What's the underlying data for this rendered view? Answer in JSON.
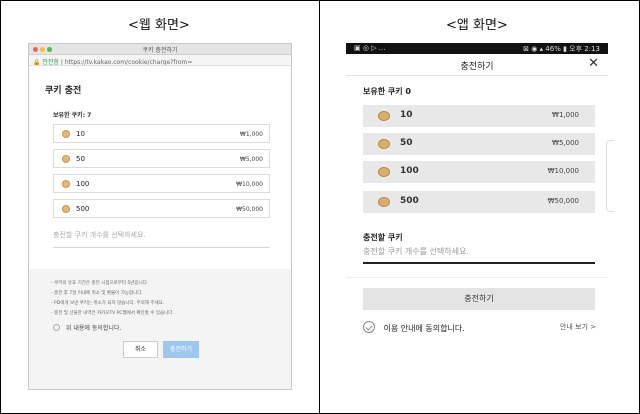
{
  "captions": {
    "web": "<웹 화면>",
    "app": "<앱 화면>"
  },
  "web": {
    "window_title": "쿠키 충전하기",
    "url_secure": "안전함",
    "url": "https://tv.kakao.com/cookie/charge?from=",
    "page_title": "쿠키 충전",
    "owned": "보유한 쿠키: 7",
    "options": [
      {
        "amount": "10",
        "price": "₩1,000"
      },
      {
        "amount": "50",
        "price": "₩5,000"
      },
      {
        "amount": "100",
        "price": "₩10,000"
      },
      {
        "amount": "500",
        "price": "₩50,000"
      }
    ],
    "input_placeholder": "충전할 쿠키 개수를 선택하세요.",
    "notices": [
      "- 쿠키의 유효 기간은 충전 시점으로부터 5년입니다.",
      "- 충전 후 7일 이내에 취소 및 환불이 가능합니다.",
      "- PD에게 보낸 쿠키는 취소가 되지 않습니다. 주의해 주세요.",
      "- 충전 및 선물한 내역은 카카오TV PC웹에서 확인할 수 있습니다."
    ],
    "agree": "위 내용에 동의합니다.",
    "cancel": "취소",
    "charge": "충전하기"
  },
  "app": {
    "status_left": "▣ ◎ ▷ ...",
    "status_right": "⊠ ◉ ▴ 46% ▮ 오후 2:13",
    "title": "충전하기",
    "close": "✕",
    "owned": "보유한 쿠키 0",
    "options": [
      {
        "amount": "10",
        "price": "₩1,000"
      },
      {
        "amount": "50",
        "price": "₩5,000"
      },
      {
        "amount": "100",
        "price": "₩10,000"
      },
      {
        "amount": "500",
        "price": "₩50,000"
      }
    ],
    "input_label": "충전할 쿠키",
    "input_placeholder": "충전할 쿠키 개수를 선택하세요.",
    "charge": "충전하기",
    "agree": "이용 안내에 동의합니다.",
    "guide": "안내 보기 >"
  }
}
